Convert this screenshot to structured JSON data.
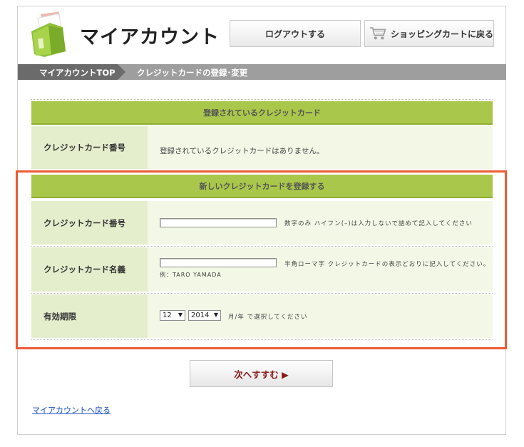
{
  "header": {
    "title": "マイアカウント",
    "logout_label": "ログアウトする",
    "shop_label": "ショッピングカートに戻る"
  },
  "breadcrumb": {
    "home": "マイアカウントTOP",
    "current": "クレジットカードの登録･変更"
  },
  "registered": {
    "heading": "登録されているクレジットカード",
    "label": "クレジットカード番号",
    "value": "登録されているクレジットカードはありません。"
  },
  "new_card": {
    "heading": "新しいクレジットカードを登録する",
    "number": {
      "label": "クレジットカード番号",
      "value": "",
      "hint": "数字のみ ハイフン(–)は入力しないで詰めて記入してください"
    },
    "name": {
      "label": "クレジットカード名義",
      "value": "",
      "hint": "半角ローマ字 クレジットカードの表示どおりに記入してください。",
      "example": "例：TARO YAMADA"
    },
    "expiry": {
      "label": "有効期限",
      "month": "12",
      "year": "2014",
      "hint": "月/年 で選択してください"
    }
  },
  "actions": {
    "next_label": "次へすすむ ▶",
    "back_label": "マイアカウントへ戻る"
  },
  "colors": {
    "accent_green": "#a9c74a",
    "highlight_red": "#ee5a32"
  }
}
